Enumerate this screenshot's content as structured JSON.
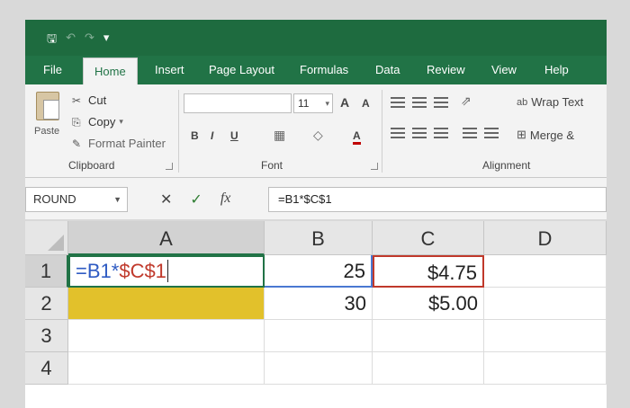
{
  "titlebar": {
    "save_icon": "save-icon",
    "undo_icon": "undo-icon",
    "redo_icon": "redo-icon"
  },
  "tabs": [
    {
      "label": "File"
    },
    {
      "label": "Home"
    },
    {
      "label": "Insert"
    },
    {
      "label": "Page Layout"
    },
    {
      "label": "Formulas"
    },
    {
      "label": "Data"
    },
    {
      "label": "Review"
    },
    {
      "label": "View"
    },
    {
      "label": "Help"
    }
  ],
  "ribbon": {
    "clipboard": {
      "paste": "Paste",
      "cut": "Cut",
      "copy": "Copy",
      "format_painter": "Format Painter",
      "label": "Clipboard"
    },
    "font": {
      "size": "11",
      "label": "Font",
      "bold": "B",
      "italic": "I",
      "underline": "U",
      "font_color": "A",
      "grow": "A",
      "shrink": "A"
    },
    "alignment": {
      "wrap_text": "Wrap Text",
      "merge": "Merge &",
      "label": "Alignment"
    }
  },
  "formula_bar": {
    "name_box": "ROUND",
    "cancel": "✕",
    "enter": "✓",
    "fx": "fx",
    "formula": "=B1*$C$1"
  },
  "sheet": {
    "columns": [
      "A",
      "B",
      "C",
      "D"
    ],
    "rows": [
      "1",
      "2",
      "3",
      "4"
    ],
    "cells": {
      "A1_part1": "=B1*",
      "A1_part2": "$C$1",
      "B1": "25",
      "C1": "$4.75",
      "B2": "30",
      "C2": "$5.00"
    }
  },
  "colors": {
    "excel_green": "#217346",
    "highlight_yellow": "#e2c12b",
    "ref_blue": "#2f5bc3",
    "ref_red": "#c0392b"
  }
}
